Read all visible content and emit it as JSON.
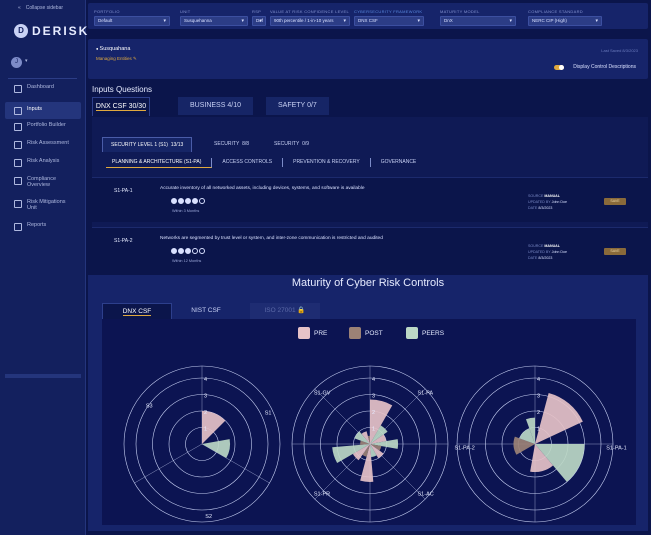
{
  "sidebar": {
    "collapse_label": "Collapse sidebar",
    "logo_text": "DERISK",
    "logo_mark": "D",
    "avatar_initial": "J",
    "items": [
      {
        "label": "Dashboard",
        "icon": "dashboard-icon"
      },
      {
        "label": "Inputs",
        "icon": "inputs-icon"
      },
      {
        "label": "Portfolio Builder",
        "icon": "portfolio-icon"
      },
      {
        "label": "Risk Assessment",
        "icon": "assessment-icon"
      },
      {
        "label": "Risk Analysis",
        "icon": "analysis-icon"
      },
      {
        "label": "Compliance Overview",
        "icon": "compliance-icon"
      },
      {
        "label": "Risk Mitigations Unit",
        "icon": "mitigation-icon"
      },
      {
        "label": "Reports",
        "icon": "reports-icon"
      }
    ]
  },
  "filters": [
    {
      "label": "PORTFOLIO",
      "value": "Default"
    },
    {
      "label": "UNIT",
      "value": "Susquehanna"
    },
    {
      "label": "RSP",
      "value": "Def"
    },
    {
      "label": "VALUE AT RISK CONFIDENCE LEVEL",
      "value": "90th percentile / 1-in-10 years"
    },
    {
      "label": "CYBERSECURITY FRAMEWORK",
      "value": "DNX CSF"
    },
    {
      "label": "MATURITY MODEL",
      "value": "DnX"
    },
    {
      "label": "COMPLIANCE STANDARD",
      "value": "NERC CIP (High)"
    }
  ],
  "header": {
    "company": "Susquahana",
    "managing": "Managing Entities ✎",
    "last_saved": "Last Saved  8/3/2023",
    "toggle_label": "Display Control Descriptions"
  },
  "inputs": {
    "title": "Inputs Questions",
    "tabs": [
      {
        "label": "DNX CSF",
        "count": "30/30"
      },
      {
        "label": "BUSINESS",
        "count": "4/10"
      },
      {
        "label": "SAFETY",
        "count": "0/7"
      }
    ],
    "security_tabs": [
      {
        "label": "SECURITY LEVEL 1 (S1)",
        "count": "13/13"
      },
      {
        "label": "SECURITY",
        "count": "8/8"
      },
      {
        "label": "SECURITY",
        "count": "0/9"
      }
    ],
    "categories": [
      "PLANNING & ARCHITECTURE (S1-PA)",
      "ACCESS CONTROLS",
      "PREVENTION & RECOVERY",
      "GOVERNANCE"
    ],
    "questions": [
      {
        "code": "S1-PA-1",
        "text": "Accurate inventory of all networked assets, including devices, systems, and software is available",
        "within": "Within 3 Months",
        "level": 4,
        "source_label": "SOURCE",
        "source": "MANUAL",
        "updated_label": "UPDATED BY",
        "updated_by": "John Doe",
        "date_label": "DATE",
        "date": "8/3/2023",
        "save": "SAVE"
      },
      {
        "code": "S1-PA-2",
        "text": "Networks are segmented by trust level or system, and inter-zone communication is restricted and audited",
        "within": "Within 12 Months",
        "level": 3,
        "source_label": "SOURCE",
        "source": "MANUAL",
        "updated_label": "UPDATED BY",
        "updated_by": "John Doe",
        "date_label": "DATE",
        "date": "8/3/2023",
        "save": "SAVE"
      }
    ]
  },
  "maturity": {
    "title": "Maturity of Cyber Risk Controls",
    "tabs": [
      "DNX CSF",
      "NIST CSF",
      "ISO 27001 🔒"
    ],
    "colors": {
      "pre": "#e6c2c8",
      "post": "#9c8276",
      "peers": "#bcd8c6"
    }
  },
  "chart_data": {
    "type": "polar-area",
    "legend": [
      "PRE",
      "POST",
      "PEERS"
    ],
    "radial_ticks": [
      1,
      2,
      3,
      4
    ],
    "charts": [
      {
        "axis_labels": [
          "S1",
          "S2",
          "S3"
        ],
        "sectors": [
          {
            "series": "PRE",
            "start": 0,
            "end": 45,
            "value": 2.0
          },
          {
            "series": "PEERS",
            "start": 80,
            "end": 120,
            "value": 1.7
          }
        ]
      },
      {
        "axis_labels": [
          "S1-PA",
          "S1-AC",
          "S1-PR",
          "S1-GV"
        ],
        "sectors": [
          {
            "series": "PRE",
            "start": 0,
            "end": 30,
            "value": 2.7
          },
          {
            "series": "PEERS",
            "start": 30,
            "end": 55,
            "value": 1.3
          },
          {
            "series": "PRE",
            "start": 55,
            "end": 80,
            "value": 1.0
          },
          {
            "series": "PEERS",
            "start": 80,
            "end": 100,
            "value": 1.7
          },
          {
            "series": "POST",
            "start": 100,
            "end": 125,
            "value": 0.7
          },
          {
            "series": "PRE",
            "start": 125,
            "end": 150,
            "value": 1.0
          },
          {
            "series": "PEERS",
            "start": 150,
            "end": 175,
            "value": 0.8
          },
          {
            "series": "PRE",
            "start": 175,
            "end": 195,
            "value": 2.3
          },
          {
            "series": "POST",
            "start": 195,
            "end": 215,
            "value": 0.8
          },
          {
            "series": "PRE",
            "start": 215,
            "end": 240,
            "value": 1.2
          },
          {
            "series": "PEERS",
            "start": 240,
            "end": 265,
            "value": 2.3
          },
          {
            "series": "POST",
            "start": 265,
            "end": 290,
            "value": 0.6
          },
          {
            "series": "PEERS",
            "start": 290,
            "end": 320,
            "value": 1.0
          },
          {
            "series": "PRE",
            "start": 320,
            "end": 345,
            "value": 0.8
          },
          {
            "series": "POST",
            "start": 345,
            "end": 360,
            "value": 0.5
          }
        ]
      },
      {
        "axis_labels": [
          "S1-PA-1",
          "S1-PA-2"
        ],
        "sectors": [
          {
            "series": "PRE",
            "start": 15,
            "end": 65,
            "value": 3.2
          },
          {
            "series": "PEERS",
            "start": 90,
            "end": 140,
            "value": 3.0
          },
          {
            "series": "PRE",
            "start": 140,
            "end": 190,
            "value": 1.7
          },
          {
            "series": "POST",
            "start": 240,
            "end": 290,
            "value": 1.3
          },
          {
            "series": "PEERS",
            "start": 290,
            "end": 340,
            "value": 1.0
          },
          {
            "series": "PEERS",
            "start": 340,
            "end": 360,
            "value": 1.6
          }
        ]
      }
    ]
  }
}
